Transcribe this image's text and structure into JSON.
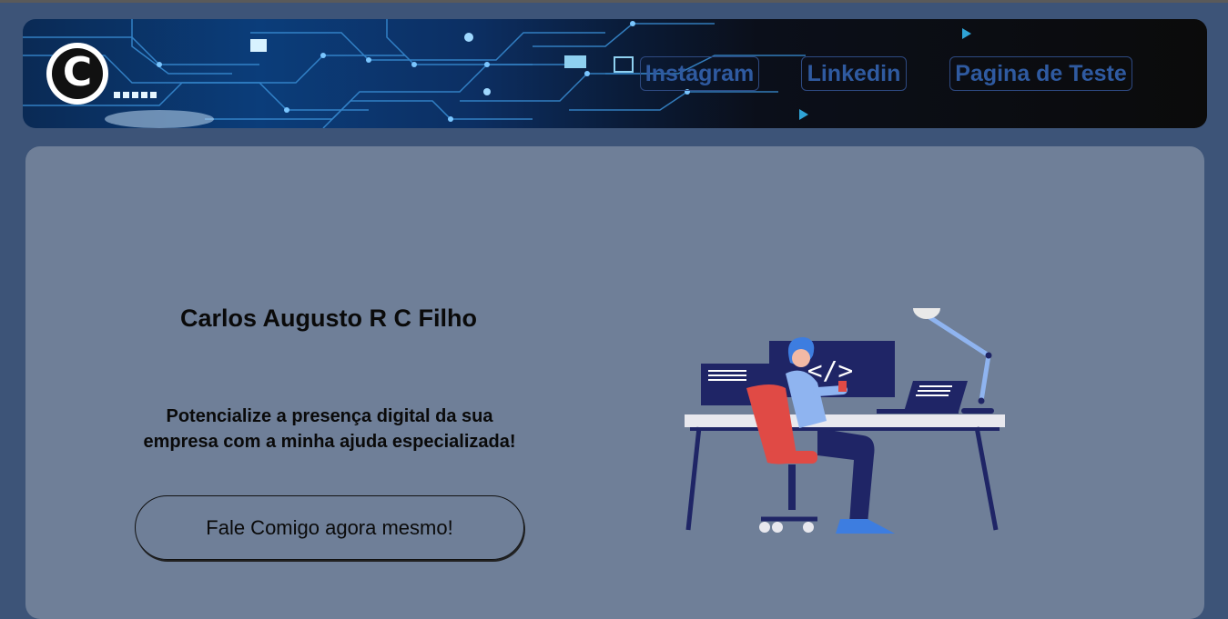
{
  "header": {
    "logo_letter": "C",
    "nav": {
      "instagram": "Instagram",
      "linkedin": "Linkedin",
      "pagina_teste": "Pagina de Teste"
    }
  },
  "hero": {
    "name": "Carlos Augusto R C Filho",
    "tagline": "Potencialize a presença digital da sua empresa com a minha ajuda especializada!",
    "cta_label": "Fale Comigo agora mesmo!",
    "code_symbol": "</>"
  },
  "colors": {
    "page_bg": "#3d5478",
    "card_bg": "#6f7f98",
    "nav_text": "#2f5aa0",
    "chair_red": "#e04a45",
    "monitor_navy": "#1f2566"
  }
}
